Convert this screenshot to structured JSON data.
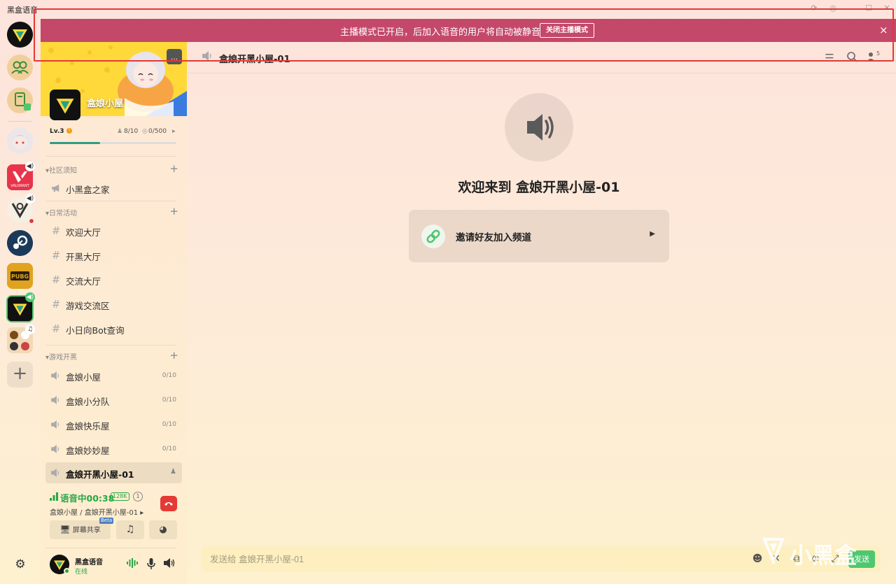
{
  "app": {
    "title": "黑盒语音"
  },
  "notice": {
    "text": "主播模式已开启，后加入语音的用户将自动被静音",
    "button": "关闭主播模式",
    "close": "×"
  },
  "rail": {
    "items": [
      {
        "name": "heybox-logo"
      },
      {
        "name": "friends"
      },
      {
        "name": "game-library"
      },
      {
        "name": "server-anime-girl"
      },
      {
        "name": "server-valorant",
        "badge": "speaker"
      },
      {
        "name": "server-destiny",
        "badge": "speaker",
        "dot": true
      },
      {
        "name": "server-steam"
      },
      {
        "name": "server-pubg"
      },
      {
        "name": "server-hezi-niang",
        "badge": "speaker",
        "active": true
      },
      {
        "name": "server-group",
        "badge": "music"
      }
    ],
    "add_label": "+",
    "settings_label": "⚙"
  },
  "server": {
    "name": "盒娘小屋",
    "level": "Lv.3",
    "members": "8/10",
    "points": "0/500",
    "level_progress": 0.4
  },
  "categories": [
    {
      "label": "社区须知",
      "channels": [
        {
          "icon": "megaphone-icon",
          "name": "小黑盒之家"
        }
      ]
    },
    {
      "label": "日常活动",
      "channels": [
        {
          "icon": "hash-icon",
          "name": "欢迎大厅"
        },
        {
          "icon": "hash-icon",
          "name": "开黑大厅"
        },
        {
          "icon": "hash-icon",
          "name": "交流大厅"
        },
        {
          "icon": "hash-icon",
          "name": "游戏交流区"
        },
        {
          "icon": "hash-icon",
          "name": "小日向Bot查询"
        }
      ]
    },
    {
      "label": "游戏开黑",
      "channels": [
        {
          "icon": "speaker-icon",
          "name": "盒娘小屋",
          "count": "0/10"
        },
        {
          "icon": "speaker-icon",
          "name": "盒娘小分队",
          "count": "0/10"
        },
        {
          "icon": "speaker-icon",
          "name": "盒娘快乐屋",
          "count": "0/10"
        },
        {
          "icon": "speaker-icon",
          "name": "盒娘妙妙屋",
          "count": "0/10"
        },
        {
          "icon": "speaker-icon",
          "name": "盒娘开黑小屋-01",
          "active": true
        }
      ]
    }
  ],
  "voice": {
    "status": "语音中00:38",
    "bitrate": "128K",
    "count": "1",
    "path": "盒娘小屋 / 盒娘开黑小屋-01 ▸",
    "screen_share": "屏幕共享",
    "beta": "Beta"
  },
  "user": {
    "name": "黑盒语音",
    "status": "在线"
  },
  "channel": {
    "title": "盒娘开黑小屋-01",
    "welcome": "欢迎来到 盒娘开黑小屋-01",
    "invite": "邀请好友加入频道",
    "header_count": "5"
  },
  "composer": {
    "placeholder": "发送给 盒娘开黑小屋-01",
    "send_label": "发送"
  },
  "watermark": {
    "text": "小黑盒"
  },
  "colors": {
    "notice_bg": "#c4486a",
    "voice_green": "#27a745",
    "hangup_red": "#e53935",
    "accent_teal": "#2b9e86"
  }
}
